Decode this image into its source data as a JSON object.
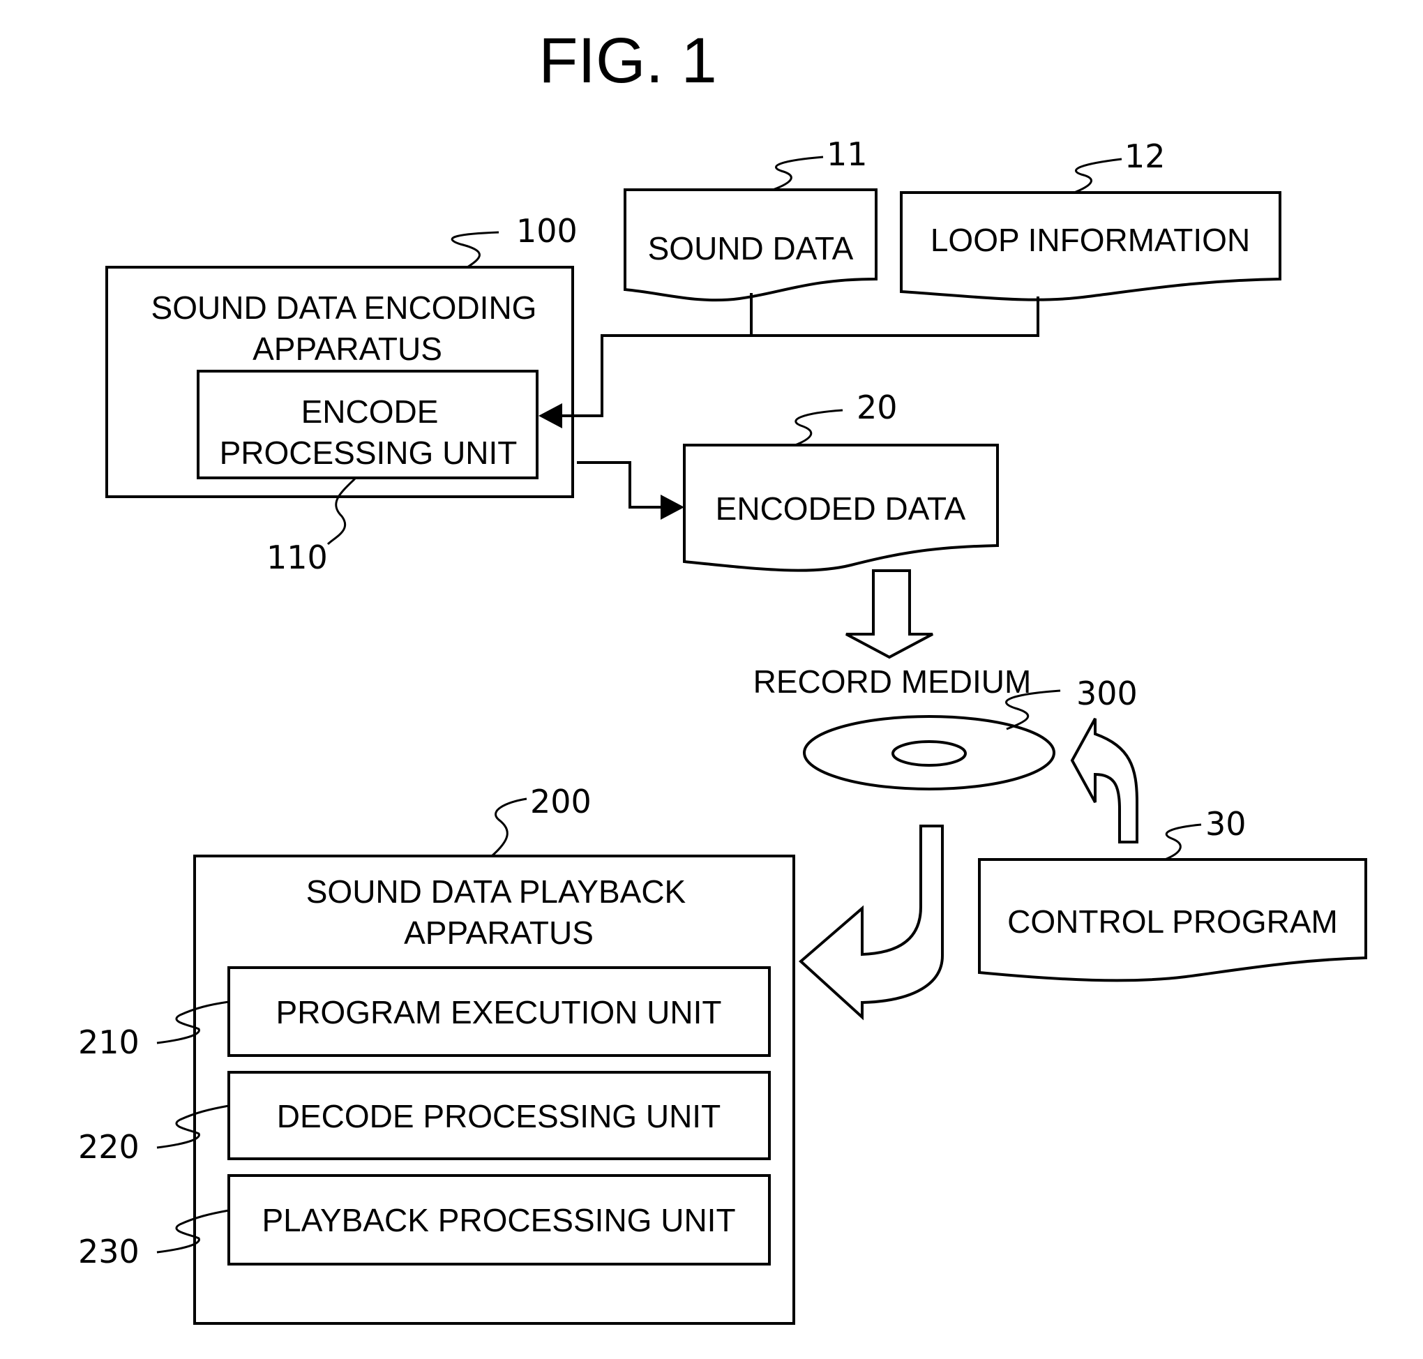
{
  "figure": {
    "title": "FIG. 1"
  },
  "blocks": {
    "encoding_apparatus": {
      "ref": "100",
      "label_line1": "SOUND DATA ENCODING",
      "label_line2": "APPARATUS"
    },
    "encode_unit": {
      "ref": "110",
      "label_line1": "ENCODE",
      "label_line2": "PROCESSING UNIT"
    },
    "sound_data": {
      "ref": "11",
      "label": "SOUND DATA"
    },
    "loop_information": {
      "ref": "12",
      "label": "LOOP INFORMATION"
    },
    "encoded_data": {
      "ref": "20",
      "label": "ENCODED DATA"
    },
    "record_medium": {
      "ref": "300",
      "label": "RECORD MEDIUM"
    },
    "control_program": {
      "ref": "30",
      "label": "CONTROL PROGRAM"
    },
    "playback_apparatus": {
      "ref": "200",
      "label_line1": "SOUND DATA PLAYBACK",
      "label_line2": "APPARATUS"
    },
    "units": [
      {
        "ref": "210",
        "label": "PROGRAM EXECUTION UNIT"
      },
      {
        "ref": "220",
        "label": "DECODE PROCESSING UNIT"
      },
      {
        "ref": "230",
        "label": "PLAYBACK PROCESSING UNIT"
      }
    ]
  }
}
